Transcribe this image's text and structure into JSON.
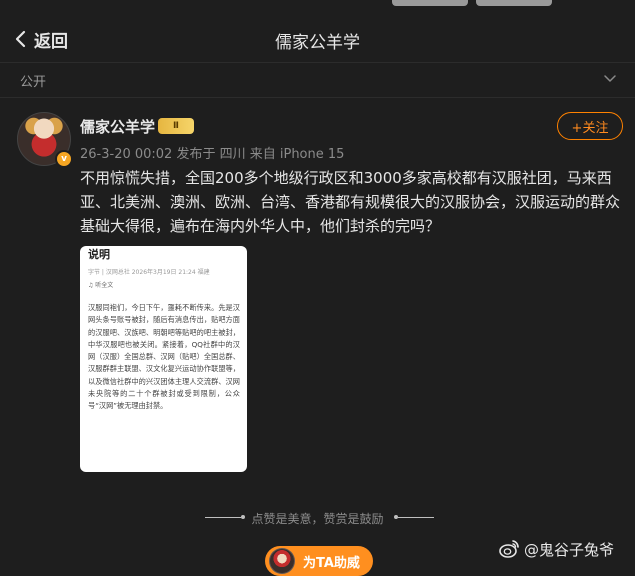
{
  "nav": {
    "back_label": "返回",
    "title": "儒家公羊学"
  },
  "visibility": {
    "label": "公开"
  },
  "post": {
    "author": "儒家公羊学",
    "vip_badge": "Ⅱ",
    "verified_mark": "v",
    "meta": "26-3-20 00:02 发布于 四川 来自 iPhone 15",
    "follow_label": "+关注",
    "text": "不用惊慌失措，全国200多个地级行政区和3000多家高校都有汉服社团，马来西亚、北美洲、澳洲、欧洲、台湾、香港都有规模很大的汉服协会，汉服运动的群众基础大得很，遍布在海内外华人中，他们封杀的完吗？"
  },
  "image": {
    "title": "说明",
    "source": "字节 | 汉网总社  2026年3月19日 21:24  福建",
    "listen": "♫ 听全文",
    "body": "汉服同袍们，今日下午，噩耗不断传来。先是汉网头条号账号被封，随后有消息传出，贴吧方面的汉服吧、汉族吧、明朝吧等贴吧的吧主被封，中华汉服吧也被关闭。紧接着，QQ社群中的汉网（汉服）全国总群、汉网（贴吧）全国总群、汉服群群主联盟、汉文化复兴运动协作联盟等，以及微信社群中的兴汉团体主理人交流群、汉网未央院等的二十个群被封或受到限制，公众号“汉网”被无理由封禁。"
  },
  "footer": {
    "divider_text": "点赞是美意，赞赏是鼓励",
    "reward_label": "为TA助威"
  },
  "watermark": {
    "text": "@鬼谷子兔爷"
  },
  "colors": {
    "accent": "#ff8200",
    "background": "#1e1e1e"
  }
}
